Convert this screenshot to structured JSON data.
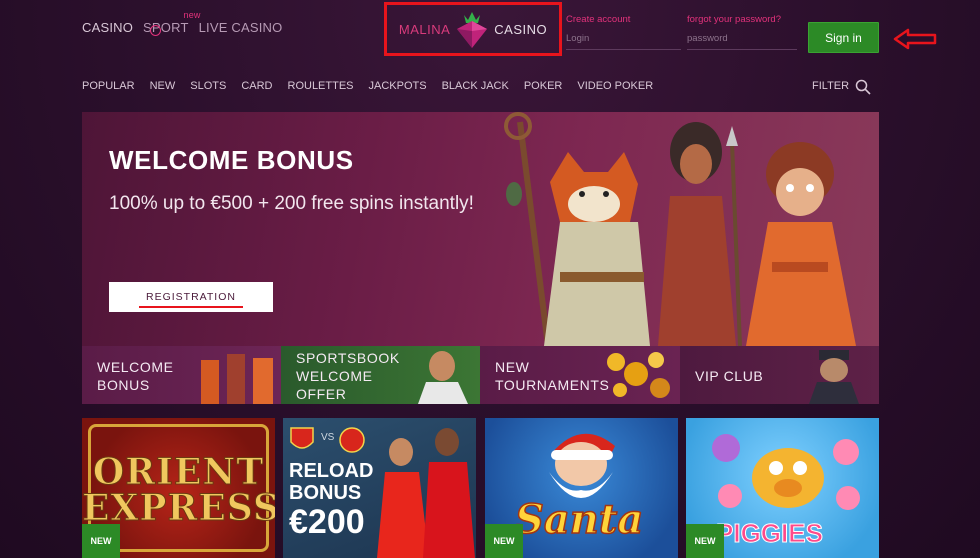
{
  "header": {
    "nav": {
      "casino": "CASINO",
      "sport": "SPORT",
      "sport_badge": "new",
      "live_casino": "LIVE CASINO"
    },
    "logo": {
      "word1": "MALINA",
      "word2": "CASINO"
    },
    "create_account": "Create account",
    "forgot_password": "forgot your password?",
    "login_placeholder": "Login",
    "password_placeholder": "password",
    "signin_label": "Sign in"
  },
  "categories": [
    "POPULAR",
    "NEW",
    "SLOTS",
    "CARD",
    "ROULETTES",
    "JACKPOTS",
    "BLACK JACK",
    "POKER",
    "VIDEO POKER"
  ],
  "filter_label": "FILTER",
  "hero": {
    "title": "WELCOME BONUS",
    "subtitle": "100% up to €500 + 200 free spins instantly!",
    "button": "REGISTRATION"
  },
  "promos": [
    {
      "line1": "WELCOME",
      "line2": "BONUS",
      "line3": ""
    },
    {
      "line1": "SPORTSBOOK",
      "line2": "WELCOME",
      "line3": "OFFER"
    },
    {
      "line1": "NEW",
      "line2": "TOURNAMENTS",
      "line3": ""
    },
    {
      "line1": "VIP CLUB",
      "line2": "",
      "line3": ""
    }
  ],
  "games": [
    {
      "title_line1": "ORIENT",
      "title_line2": "EXPRESS",
      "badge": "NEW"
    },
    {
      "vs": "VS",
      "line1": "RELOAD",
      "line2": "BONUS",
      "line3": "€200"
    },
    {
      "title": "Santa",
      "badge": "NEW"
    },
    {
      "title": "PIGGIES",
      "badge": "NEW"
    }
  ],
  "colors": {
    "accent": "#e2327b",
    "signin": "#2c8a26",
    "annotation": "#e8141c"
  }
}
